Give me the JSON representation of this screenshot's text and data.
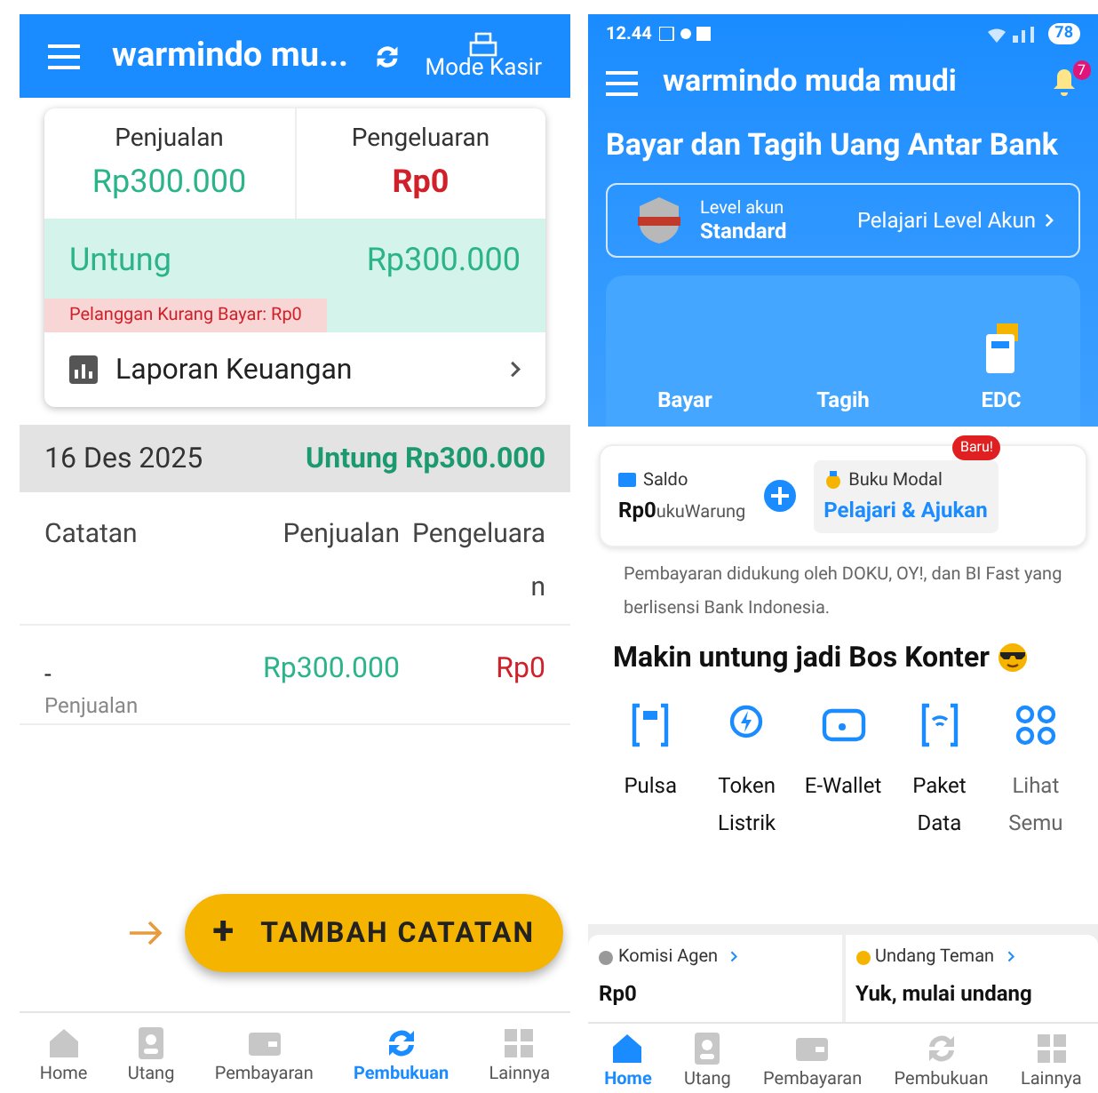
{
  "left_screen": {
    "app_bar": {
      "title": "warmindo mu...",
      "action_label": "Mode Kasir"
    },
    "summary": {
      "sales_label": "Penjualan",
      "sales_value": "Rp300.000",
      "expense_label": "Pengeluaran",
      "expense_value": "Rp0",
      "profit_label": "Untung",
      "profit_value": "Rp300.000",
      "debt_note": "Pelanggan Kurang Bayar: Rp0",
      "report_link": "Laporan Keuangan"
    },
    "day": {
      "date": "16 Des 2025",
      "profit": "Untung Rp300.000"
    },
    "table": {
      "columns": [
        "Catatan",
        "Penjualan",
        "Pengeluaran"
      ],
      "rows": [
        {
          "note": "-",
          "type": "Penjualan",
          "sales": "Rp300.000",
          "expense": "Rp0"
        }
      ]
    },
    "fab": {
      "icon": "+",
      "label": "TAMBAH CATATAN"
    },
    "nav": [
      {
        "label": "Home",
        "selected": false
      },
      {
        "label": "Utang",
        "selected": false
      },
      {
        "label": "Pembayaran",
        "selected": false
      },
      {
        "label": "Pembukuan",
        "selected": true
      },
      {
        "label": "Lainnya",
        "selected": false
      }
    ]
  },
  "right_screen": {
    "status_bar": {
      "time": "12.44",
      "battery": "78"
    },
    "app_bar": {
      "title": "warmindo muda mudi",
      "notifications": "7"
    },
    "headline": "Bayar dan Tagih Uang Antar Bank",
    "account_level": {
      "label": "Level akun",
      "value": "Standard",
      "link": "Pelajari Level Akun"
    },
    "actions": [
      "Bayar",
      "Tagih",
      "EDC"
    ],
    "balance": {
      "label": "Saldo",
      "value": "Rp0",
      "overlap_text": "ukuWarung"
    },
    "loan": {
      "label": "Buku Modal",
      "link": "Pelajari & Ajukan",
      "badge": "Baru!"
    },
    "note": "Pembayaran didukung oleh DOKU, OY!, dan BI Fast yang berlisensi Bank Indonesia.",
    "promo_title": "Makin untung jadi Bos Konter",
    "services": [
      "Pulsa",
      "Token Listrik",
      "E-Wallet",
      "Paket Data",
      "Lihat Semu"
    ],
    "cards": [
      {
        "title": "Komisi Agen",
        "value": "Rp0"
      },
      {
        "title": "Undang Teman",
        "value": "Yuk, mulai undang"
      }
    ],
    "nav": [
      {
        "label": "Home",
        "selected": true
      },
      {
        "label": "Utang",
        "selected": false
      },
      {
        "label": "Pembayaran",
        "selected": false
      },
      {
        "label": "Pembukuan",
        "selected": false
      },
      {
        "label": "Lainnya",
        "selected": false
      }
    ]
  }
}
